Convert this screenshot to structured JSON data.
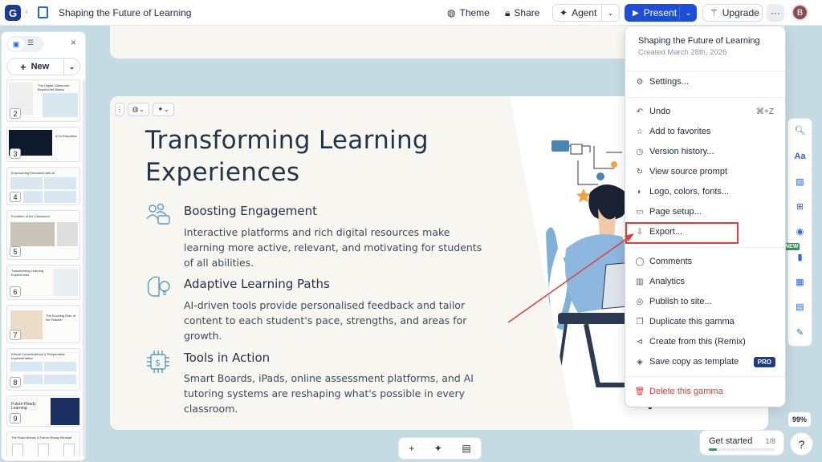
{
  "app": {
    "title": "Shaping the Future of Learning",
    "avatar_initial": "B"
  },
  "topbar": {
    "theme": "Theme",
    "share": "Share",
    "agent": "Agent",
    "present": "Present",
    "upgrade": "Upgrade",
    "more": "···"
  },
  "sidebar": {
    "new_label": "New",
    "thumbnails": [
      {
        "num": "2",
        "title": "The Digital Classroom: Beyond the Basics"
      },
      {
        "num": "3",
        "title": "AI in Education"
      },
      {
        "num": "4",
        "title": "Empowering Educators with AI"
      },
      {
        "num": "5",
        "title": "Evolution of the Classroom"
      },
      {
        "num": "6",
        "title": "Transforming Learning Experiences"
      },
      {
        "num": "7",
        "title": "The Evolving Role of the Teacher"
      },
      {
        "num": "8",
        "title": "Ethical Considerations & Responsible Implementation"
      },
      {
        "num": "9",
        "title": "Future-Ready Learning"
      },
      {
        "num": "",
        "title": "The Road Ahead: A Future-Ready Mindset"
      }
    ]
  },
  "slide": {
    "title": "Transforming Learning Experiences",
    "features": [
      {
        "title": "Boosting Engagement",
        "body": "Interactive platforms and rich digital resources make learning more active, relevant, and motivating for students of all abilities."
      },
      {
        "title": "Adaptive Learning Paths",
        "body": "AI-driven tools provide personalised feedback and tailor content to each student's pace, strengths, and areas for growth."
      },
      {
        "title": "Tools in Action",
        "body": "Smart Boards, iPads, online assessment platforms, and AI tutoring systems are reshaping what's possible in every classroom."
      }
    ]
  },
  "menu": {
    "title": "Shaping the Future of Learning",
    "created": "Created March 28th, 2026",
    "items": [
      {
        "icon": "⚙",
        "label": "Settings..."
      },
      {
        "icon": "↶",
        "label": "Undo",
        "shortcut": "⌘+Z"
      },
      {
        "icon": "☆",
        "label": "Add to favorites"
      },
      {
        "icon": "◷",
        "label": "Version history..."
      },
      {
        "icon": "↻",
        "label": "View source prompt"
      },
      {
        "icon": "◐",
        "label": "Logo, colors, fonts..."
      },
      {
        "icon": "▭",
        "label": "Page setup..."
      },
      {
        "icon": "⇩",
        "label": "Export..."
      },
      {
        "icon": "◯",
        "label": "Comments"
      },
      {
        "icon": "▥",
        "label": "Analytics"
      },
      {
        "icon": "◎",
        "label": "Publish to site..."
      },
      {
        "icon": "❐",
        "label": "Duplicate this gamma"
      },
      {
        "icon": "⊲",
        "label": "Create from this (Remix)"
      },
      {
        "icon": "◈",
        "label": "Save copy as template",
        "badge": "PRO"
      },
      {
        "icon": "🗑",
        "label": "Delete this gamma"
      }
    ]
  },
  "righttools": {
    "new_badge": "NEW"
  },
  "zoom": "99%",
  "get_started": {
    "label": "Get started",
    "count": "1/8",
    "progress": 0.125
  },
  "help": "?",
  "colors": {
    "accent": "#1d4ed8",
    "danger": "#d63a3a",
    "annotation": "#e23b3b"
  }
}
